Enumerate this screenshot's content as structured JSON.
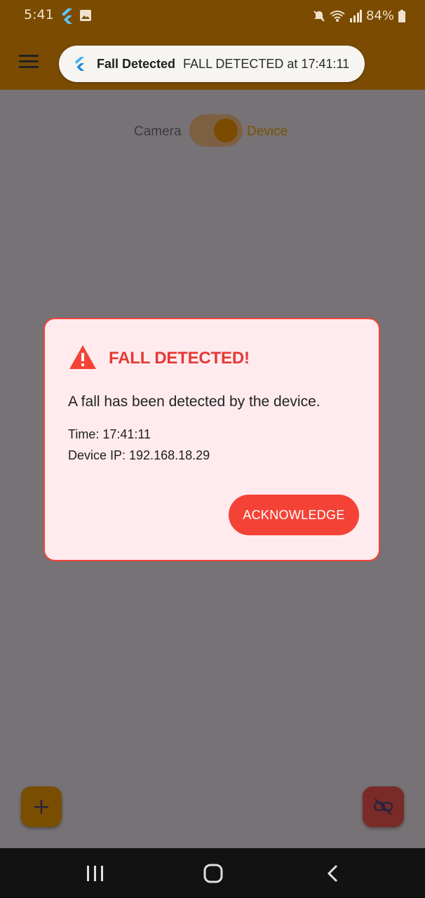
{
  "status_bar": {
    "time": "5:41",
    "battery": "84%"
  },
  "notification": {
    "title": "Fall Detected",
    "text": "FALL DETECTED at 17:41:11"
  },
  "mode_toggle": {
    "left_label": "Camera",
    "right_label": "Device",
    "selected": "Device"
  },
  "dialog": {
    "title": "FALL DETECTED!",
    "message": "A fall has been detected by the device.",
    "time_line": "Time: 17:41:11",
    "ip_line": "Device IP: 192.168.18.29",
    "button_label": "ACKNOWLEDGE"
  },
  "colors": {
    "accent": "#f44336",
    "dialog_bg": "#ffebee",
    "appbar": "#7a4b00"
  },
  "icons": [
    "menu-icon",
    "flutter-icon",
    "gallery-icon",
    "mute-icon",
    "wifi-icon",
    "signal-icon",
    "battery-icon",
    "warning-icon",
    "add-icon",
    "unlink-icon",
    "recents-icon",
    "home-icon",
    "back-icon"
  ]
}
